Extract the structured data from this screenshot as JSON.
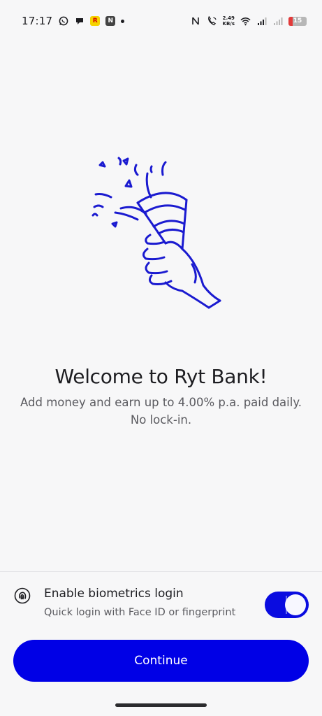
{
  "status_bar": {
    "time": "17:17",
    "speed_value": "2.49",
    "speed_unit": "KB/s",
    "battery": "15",
    "icons_left": [
      "whatsapp-icon",
      "chat-icon",
      "ryt-app-icon",
      "nfc-app-icon",
      "notification-dot"
    ],
    "icons_right": [
      "nfc-icon",
      "call-wifi-icon",
      "wifi-icon",
      "signal-icon",
      "signal-icon-2",
      "battery-icon"
    ]
  },
  "hero": {
    "icon": "party-popper-hand-illustration",
    "stroke_color": "#1a1ad0"
  },
  "welcome": {
    "title": "Welcome to Ryt Bank!",
    "subtitle_line1": "Add money and earn up to 4.00% p.a. paid daily.",
    "subtitle_line2": "No lock-in."
  },
  "biometrics": {
    "icon": "fingerprint-icon",
    "title": "Enable biometrics login",
    "subtitle": "Quick login with Face ID or fingerprint",
    "enabled": true
  },
  "actions": {
    "continue_label": "Continue"
  },
  "colors": {
    "primary": "#0000e6",
    "background": "#f7f7f8",
    "text_primary": "#1d1d21",
    "text_secondary": "#5b5b60"
  }
}
